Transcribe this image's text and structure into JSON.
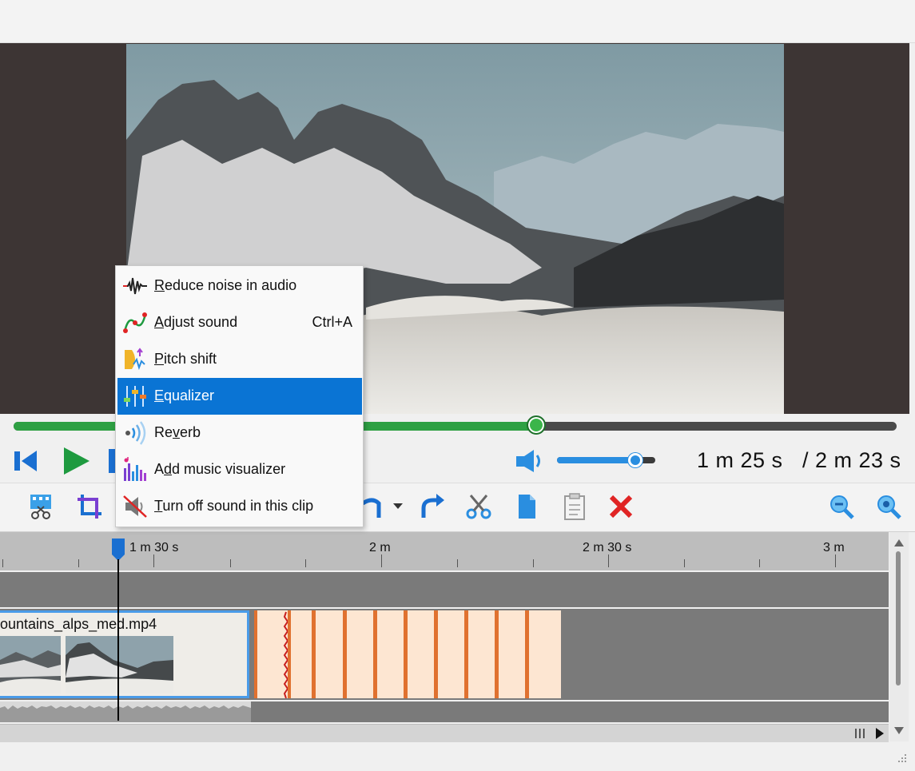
{
  "player": {
    "progress_fraction": 0.592,
    "volume_fraction": 0.8,
    "time_current": "1 m 25 s",
    "time_total": "/ 2 m 23 s"
  },
  "context_menu": {
    "items": [
      {
        "label": "Reduce noise in audio",
        "shortcut": "",
        "icon": "noise-reduction-icon",
        "selected": false
      },
      {
        "label": "Adjust sound",
        "shortcut": "Ctrl+A",
        "icon": "adjust-sound-icon",
        "selected": false
      },
      {
        "label": "Pitch shift",
        "shortcut": "",
        "icon": "pitch-shift-icon",
        "selected": false
      },
      {
        "label": "Equalizer",
        "shortcut": "",
        "icon": "equalizer-icon",
        "selected": true
      },
      {
        "label": "Reverb",
        "shortcut": "",
        "icon": "reverb-icon",
        "selected": false
      },
      {
        "label": "Add music visualizer",
        "shortcut": "",
        "icon": "music-visualizer-icon",
        "selected": false
      },
      {
        "label": "Turn off sound in this clip",
        "shortcut": "",
        "icon": "mute-icon",
        "selected": false
      }
    ]
  },
  "toolbar": {
    "icons": [
      "split-clip-icon",
      "crop-icon",
      "undo-icon",
      "undo-dropdown-icon",
      "redo-icon",
      "cut-icon",
      "copy-icon",
      "paste-icon",
      "delete-icon",
      "zoom-out-icon",
      "zoom-in-icon"
    ]
  },
  "timeline": {
    "ruler_labels": [
      "1 m 30 s",
      "2 m",
      "2 m 30 s",
      "3 m"
    ],
    "clip_name": "ountains_alps_med.mp4"
  },
  "colors": {
    "progress": "#2ea043",
    "selection": "#0a74d4",
    "volume": "#2a8ee0",
    "transition": "#fde6d2",
    "transition_stripe": "#e0712f"
  }
}
